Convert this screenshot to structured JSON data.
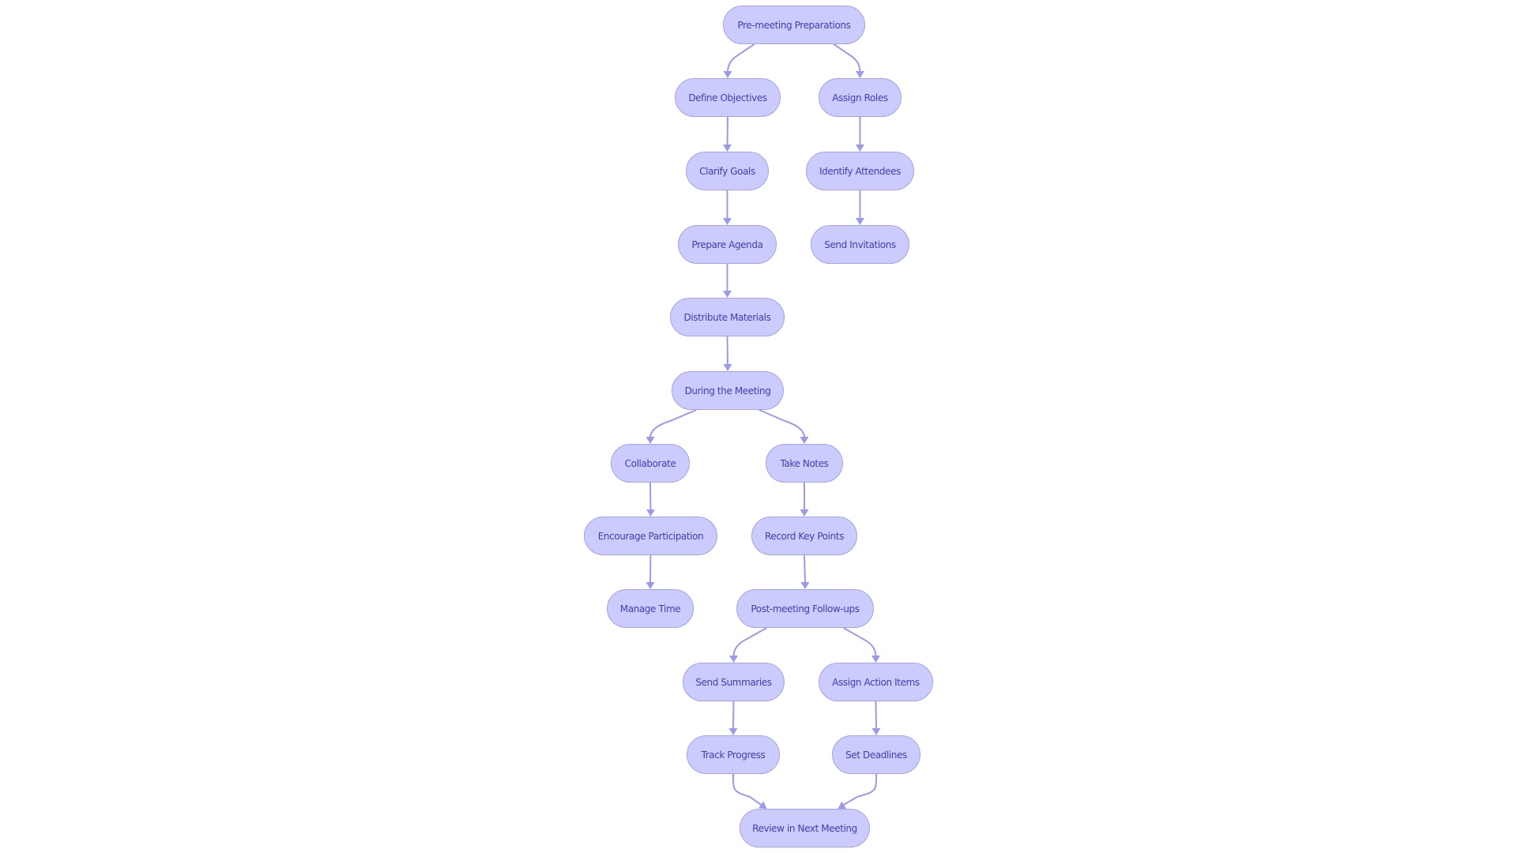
{
  "diagram": {
    "type": "flowchart",
    "direction": "top-down",
    "colors": {
      "node_fill": "#cbcbfe",
      "node_border": "#a3a3e6",
      "node_text": "#3e3eb3",
      "edge": "#9a9ae8",
      "background": "#ffffff"
    },
    "nodes": [
      {
        "id": "pre",
        "label": "Pre-meeting Preparations"
      },
      {
        "id": "obj",
        "label": "Define Objectives"
      },
      {
        "id": "roles",
        "label": "Assign Roles"
      },
      {
        "id": "goals",
        "label": "Clarify Goals"
      },
      {
        "id": "attendees",
        "label": "Identify Attendees"
      },
      {
        "id": "agenda",
        "label": "Prepare Agenda"
      },
      {
        "id": "invites",
        "label": "Send Invitations"
      },
      {
        "id": "materials",
        "label": "Distribute Materials"
      },
      {
        "id": "during",
        "label": "During the Meeting"
      },
      {
        "id": "collab",
        "label": "Collaborate"
      },
      {
        "id": "notes",
        "label": "Take Notes"
      },
      {
        "id": "encourage",
        "label": "Encourage Participation"
      },
      {
        "id": "keypoints",
        "label": "Record Key Points"
      },
      {
        "id": "time",
        "label": "Manage Time"
      },
      {
        "id": "post",
        "label": "Post-meeting Follow-ups"
      },
      {
        "id": "summaries",
        "label": "Send Summaries"
      },
      {
        "id": "actions",
        "label": "Assign Action Items"
      },
      {
        "id": "progress",
        "label": "Track Progress"
      },
      {
        "id": "deadlines",
        "label": "Set Deadlines"
      },
      {
        "id": "review",
        "label": "Review in Next Meeting"
      }
    ],
    "edges": [
      {
        "from": "pre",
        "to": "obj"
      },
      {
        "from": "pre",
        "to": "roles"
      },
      {
        "from": "obj",
        "to": "goals"
      },
      {
        "from": "roles",
        "to": "attendees"
      },
      {
        "from": "goals",
        "to": "agenda"
      },
      {
        "from": "attendees",
        "to": "invites"
      },
      {
        "from": "agenda",
        "to": "materials"
      },
      {
        "from": "materials",
        "to": "during"
      },
      {
        "from": "during",
        "to": "collab"
      },
      {
        "from": "during",
        "to": "notes"
      },
      {
        "from": "collab",
        "to": "encourage"
      },
      {
        "from": "notes",
        "to": "keypoints"
      },
      {
        "from": "encourage",
        "to": "time"
      },
      {
        "from": "keypoints",
        "to": "post"
      },
      {
        "from": "post",
        "to": "summaries"
      },
      {
        "from": "post",
        "to": "actions"
      },
      {
        "from": "summaries",
        "to": "progress"
      },
      {
        "from": "actions",
        "to": "deadlines"
      },
      {
        "from": "progress",
        "to": "review"
      },
      {
        "from": "deadlines",
        "to": "review"
      }
    ]
  }
}
